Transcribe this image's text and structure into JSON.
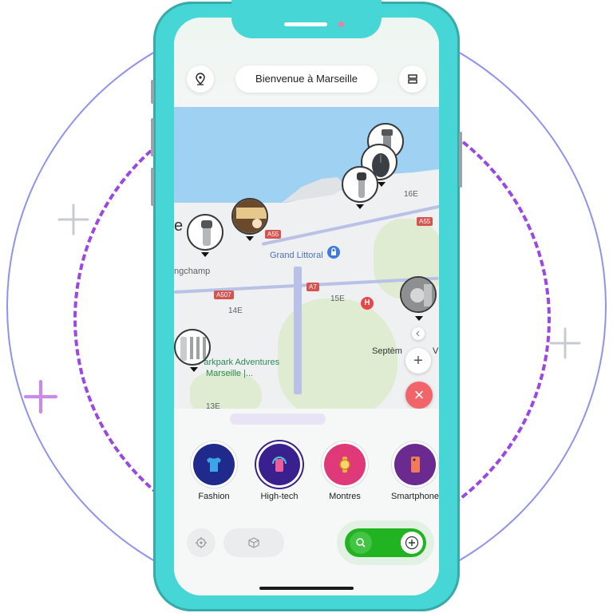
{
  "header": {
    "title": "Bienvenue à Marseille",
    "left_icon": "location-pin-icon",
    "right_icon": "list-view-icon"
  },
  "map": {
    "labels": {
      "grand_littoral": "Grand Littoral",
      "park": "Parkpark Adventures",
      "park_line2": "Marseille |...",
      "longchamp": "ngchamp",
      "arr14": "14E",
      "arr15": "15E",
      "arr16": "16E",
      "arr13": "13E",
      "septemes": "Septèm",
      "edge_e": "e",
      "edge_v": "V",
      "a55": "A55",
      "a55b": "A55",
      "a507": "A507",
      "a7": "A7"
    },
    "hospital_label": "H",
    "controls": {
      "zoom_in": "+",
      "close": "×"
    }
  },
  "categories": [
    {
      "label": "Fashion",
      "color": "#1f2a8c",
      "icon": "tshirt-icon"
    },
    {
      "label": "High-tech",
      "color": "#3a1f8f",
      "icon": "phone-tech-icon"
    },
    {
      "label": "Montres",
      "color": "#e0397a",
      "icon": "watch-icon"
    },
    {
      "label": "Smartphone",
      "color": "#6b2a8f",
      "icon": "smartphone-icon"
    }
  ],
  "bottom_bar": {
    "locate_icon": "crosshair-icon",
    "package_icon": "package-icon",
    "search_icon": "search-icon",
    "add_icon": "add-icon"
  },
  "colors": {
    "phone_frame": "#47d6d6",
    "accent_green": "#22b322",
    "close_red": "#f0646a",
    "dashed_ring": "#9b46e6"
  }
}
